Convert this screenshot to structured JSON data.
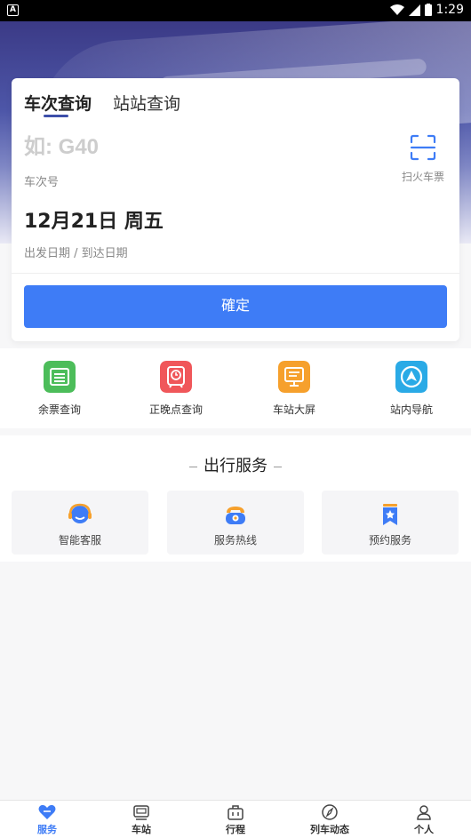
{
  "status_bar": {
    "time": "1:29"
  },
  "query_card": {
    "tabs": [
      {
        "label": "车次查询",
        "active": true
      },
      {
        "label": "站站查询",
        "active": false
      }
    ],
    "train_number": {
      "placeholder": "如: G40",
      "label": "车次号"
    },
    "scan": {
      "label": "扫火车票",
      "icon": "scan-icon"
    },
    "date": {
      "value": "12月21日 周五",
      "label": "出发日期 / 到达日期"
    },
    "confirm_label": "確定"
  },
  "quick_menu": [
    {
      "label": "余票查询",
      "icon": "ticket-list-icon",
      "color": "#4cbd5a"
    },
    {
      "label": "正晚点查询",
      "icon": "train-clock-icon",
      "color": "#f0575a"
    },
    {
      "label": "车站大屏",
      "icon": "display-board-icon",
      "color": "#f6a02c"
    },
    {
      "label": "站内导航",
      "icon": "navigation-icon",
      "color": "#2aaae6"
    }
  ],
  "travel_services": {
    "title": "出行服务",
    "items": [
      {
        "label": "智能客服",
        "icon": "customer-service-icon"
      },
      {
        "label": "服务热线",
        "icon": "phone-icon"
      },
      {
        "label": "预约服务",
        "icon": "bookmark-star-icon"
      }
    ]
  },
  "bottom_nav": [
    {
      "label": "服务",
      "icon": "heart-icon",
      "active": true
    },
    {
      "label": "车站",
      "icon": "station-icon",
      "active": false
    },
    {
      "label": "行程",
      "icon": "luggage-icon",
      "active": false
    },
    {
      "label": "列车动态",
      "icon": "compass-icon",
      "active": false
    },
    {
      "label": "个人",
      "icon": "user-icon",
      "active": false
    }
  ],
  "colors": {
    "primary": "#3e7cf6",
    "tab_indicator": "#3d4faa"
  }
}
